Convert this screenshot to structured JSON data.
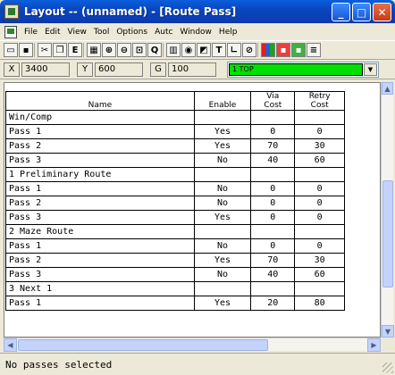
{
  "window": {
    "title": "Layout -- (unnamed) - [Route Pass]",
    "controls": {
      "minimize": "_",
      "maximize": "□",
      "close": "✕"
    }
  },
  "menu": [
    "File",
    "Edit",
    "View",
    "Tool",
    "Options",
    "Autc",
    "Window",
    "Help"
  ],
  "toolbar": {
    "icons": [
      "open-icon",
      "save-icon",
      "print-icon",
      "cut-icon",
      "copy-icon",
      "edit-icon",
      "grid-icon",
      "zoom-in-icon",
      "zoom-out-icon",
      "zoom-area-icon",
      "query-icon",
      "component-icon",
      "pin-icon",
      "shape-icon",
      "text-icon",
      "line-icon",
      "no-icon",
      "color-icon",
      "drc-icon",
      "route-icon"
    ],
    "letters": {
      "edit": "E",
      "text": "T"
    }
  },
  "coords": {
    "x_label": "X",
    "x_value": "3400",
    "y_label": "Y",
    "y_value": "600",
    "g_label": "G",
    "g_value": "100",
    "layer": "1 TOP",
    "layer_color": "#00e000"
  },
  "table": {
    "headers": {
      "name": "Name",
      "enable": "Enable",
      "via": "Via\nCost",
      "retry": "Retry\nCost"
    },
    "rows": [
      {
        "name": "Win/Comp",
        "group": true
      },
      {
        "name": "Pass 1",
        "enable": "Yes",
        "via": "0",
        "retry": "0"
      },
      {
        "name": "Pass 2",
        "enable": "Yes",
        "via": "70",
        "retry": "30"
      },
      {
        "name": "Pass 3",
        "enable": "No",
        "via": "40",
        "retry": "60"
      },
      {
        "name": "1 Preliminary Route",
        "group": true
      },
      {
        "name": "Pass 1",
        "enable": "No",
        "via": "0",
        "retry": "0"
      },
      {
        "name": "Pass 2",
        "enable": "No",
        "via": "0",
        "retry": "0"
      },
      {
        "name": "Pass 3",
        "enable": "Yes",
        "via": "0",
        "retry": "0"
      },
      {
        "name": "2 Maze Route",
        "group": true
      },
      {
        "name": "Pass 1",
        "enable": "No",
        "via": "0",
        "retry": "0"
      },
      {
        "name": "Pass 2",
        "enable": "Yes",
        "via": "70",
        "retry": "30"
      },
      {
        "name": "Pass 3",
        "enable": "No",
        "via": "40",
        "retry": "60"
      },
      {
        "name": "3 Next 1",
        "group": true
      },
      {
        "name": "Pass 1",
        "enable": "Yes",
        "via": "20",
        "retry": "80"
      }
    ]
  },
  "status": "No passes selected"
}
